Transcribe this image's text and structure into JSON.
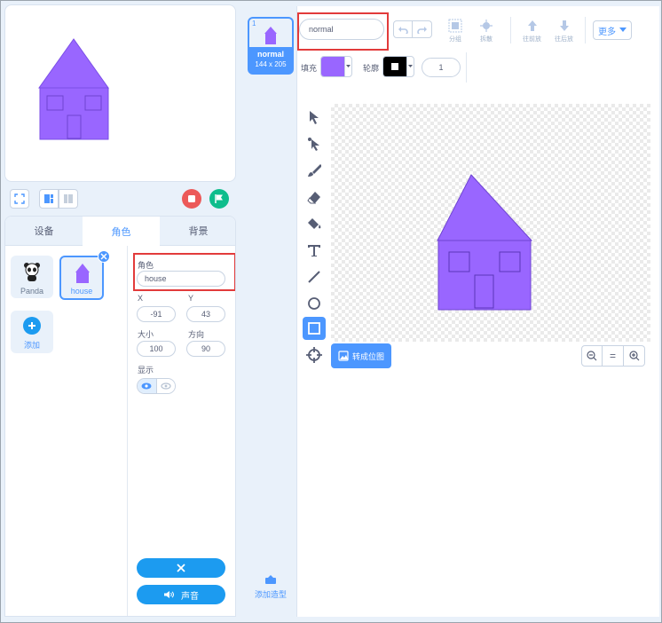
{
  "stage": {},
  "tabs": {
    "devices": "设备",
    "sprites": "角色",
    "backdrops": "背景"
  },
  "sprites": [
    {
      "name": "Panda"
    },
    {
      "name": "house"
    }
  ],
  "add_sprite_label": "添加",
  "sprite_info": {
    "sprite_label": "角色",
    "sprite_name": "house",
    "x_label": "X",
    "x_value": "-91",
    "y_label": "Y",
    "y_value": "43",
    "size_label": "大小",
    "size_value": "100",
    "direction_label": "方向",
    "direction_value": "90",
    "show_label": "显示"
  },
  "sound_button": "声音",
  "costume": {
    "index": "1",
    "name": "normal",
    "size": "144 x 205"
  },
  "add_costume_label": "添加造型",
  "editor": {
    "costume_name": "normal",
    "group": "分组",
    "ungroup": "拆散",
    "forward": "往前放",
    "backward": "往后放",
    "more": "更多",
    "fill_label": "填充",
    "outline_label": "轮廓",
    "outline_width": "1",
    "convert_bitmap": "转成位图",
    "zoom_reset": "="
  },
  "colors": {
    "accent": "#4c97ff",
    "shape_fill": "#9966ff",
    "stop": "#ec5959",
    "go": "#0fbd8c",
    "highlight": "#e23b3b"
  }
}
